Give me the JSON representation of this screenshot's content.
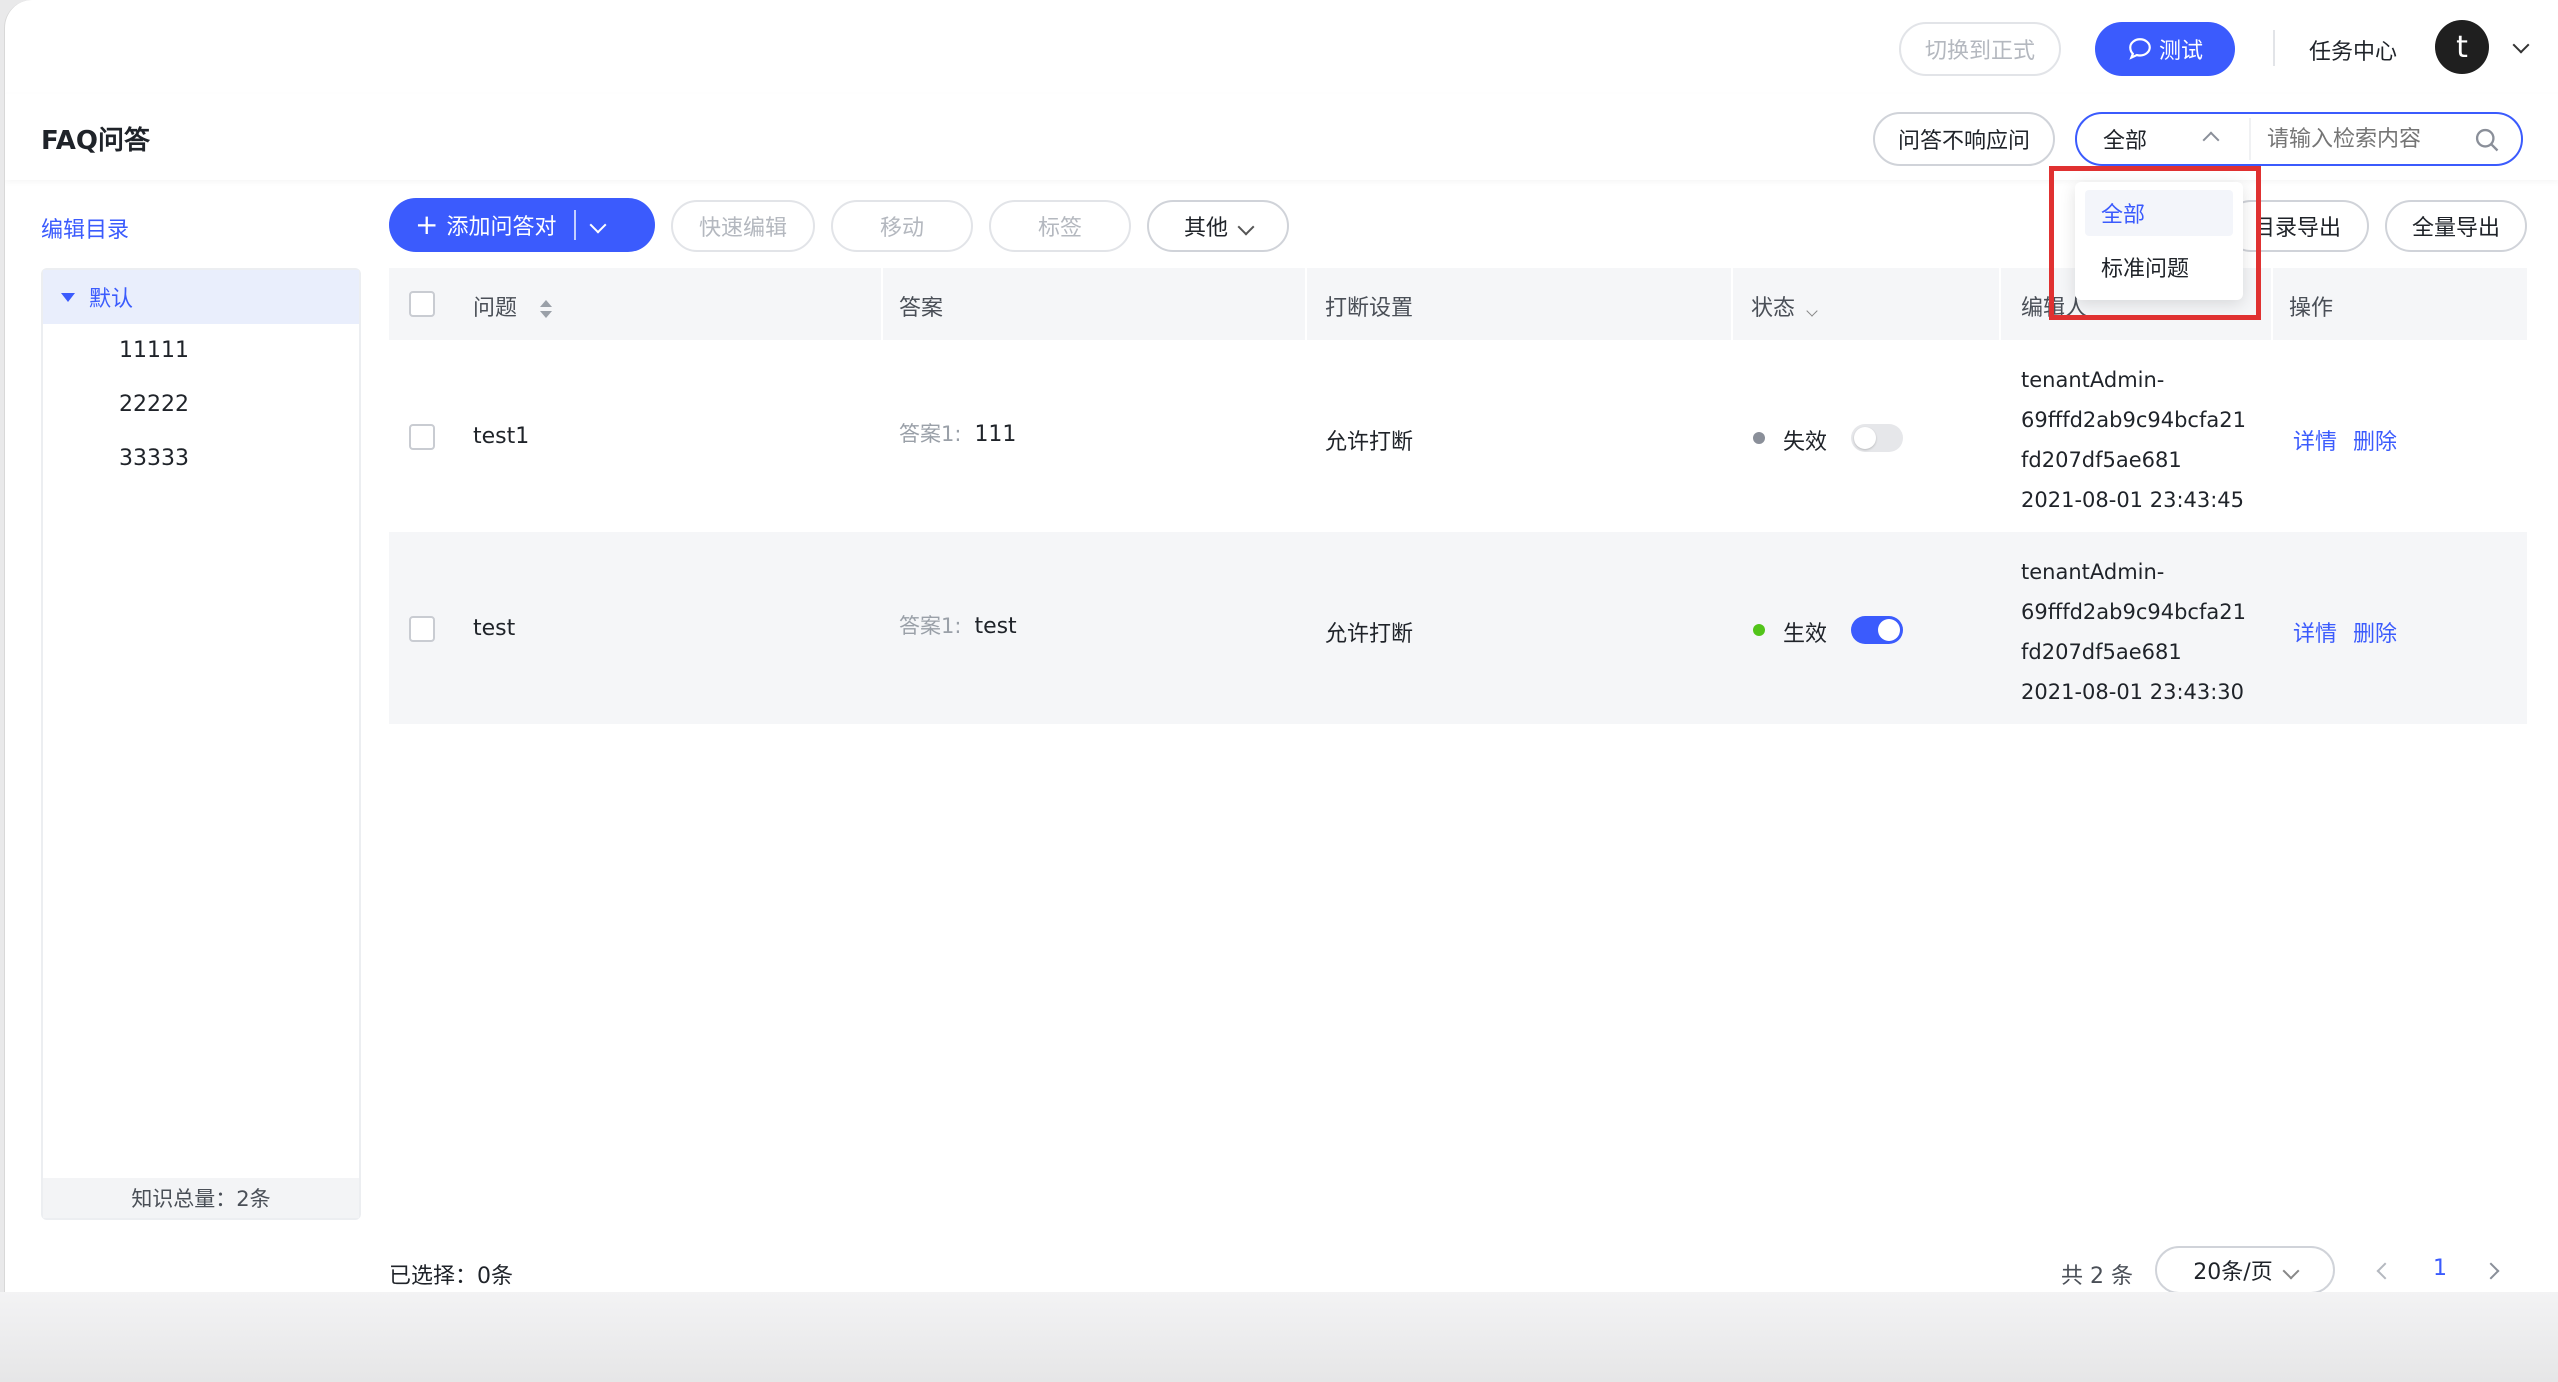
{
  "topbar": {
    "switch_formal": "切换到正式",
    "test_button": "测试",
    "task_center": "任务中心",
    "avatar_letter": "t"
  },
  "header": {
    "title": "FAQ问答",
    "unanswered_button": "问答不响应问",
    "filter_selected": "全部",
    "search_placeholder": "请输入检索内容"
  },
  "dropdown": {
    "options": [
      "全部",
      "标准问题"
    ],
    "selected_index": 0
  },
  "sidebar": {
    "edit_catalog": "编辑目录",
    "root": "默认",
    "children": [
      "11111",
      "22222",
      "33333"
    ],
    "footer": "知识总量：2条"
  },
  "toolbar": {
    "add_qa": "添加问答对",
    "quick_edit": "快速编辑",
    "move": "移动",
    "tag": "标签",
    "other": "其他",
    "catalog_export": "目录导出",
    "full_export": "全量导出"
  },
  "table": {
    "columns": [
      "问题",
      "答案",
      "打断设置",
      "状态",
      "编辑人",
      "操作"
    ],
    "answer_prefix": "答案1:",
    "rows": [
      {
        "question": "test1",
        "answer": "111",
        "interrupt": "允许打断",
        "status": "失效",
        "status_on": false,
        "editor_lines": [
          "tenantAdmin-",
          "69fffd2ab9c94bcfa21",
          "fd207df5ae681",
          "2021-08-01 23:43:45"
        ],
        "action_detail": "详情",
        "action_delete": "删除"
      },
      {
        "question": "test",
        "answer": "test",
        "interrupt": "允许打断",
        "status": "生效",
        "status_on": true,
        "editor_lines": [
          "tenantAdmin-",
          "69fffd2ab9c94bcfa21",
          "fd207df5ae681",
          "2021-08-01 23:43:30"
        ],
        "action_detail": "详情",
        "action_delete": "删除"
      }
    ]
  },
  "footer": {
    "selected": "已选择：0条",
    "total": "共 2 条",
    "page_size": "20条/页",
    "current_page": "1"
  },
  "colors": {
    "accent": "#3b5bfd",
    "highlight_box": "#e03131",
    "status_active": "#52c41a",
    "status_inactive": "#8a8f99"
  }
}
